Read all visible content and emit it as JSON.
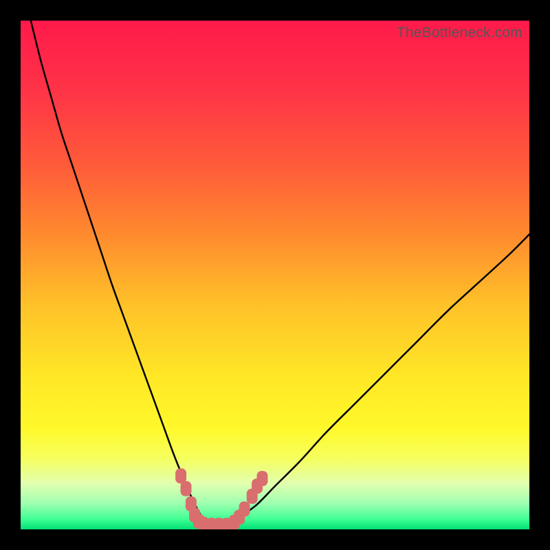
{
  "watermark": "TheBottleneck.com",
  "colors": {
    "frame": "#000000",
    "curve": "#000000",
    "marker": "#d96e6e",
    "gradient_stops": [
      {
        "offset": 0.0,
        "color": "#ff1a4b"
      },
      {
        "offset": 0.14,
        "color": "#ff3447"
      },
      {
        "offset": 0.28,
        "color": "#ff5a3a"
      },
      {
        "offset": 0.42,
        "color": "#ff8a2e"
      },
      {
        "offset": 0.56,
        "color": "#ffc229"
      },
      {
        "offset": 0.7,
        "color": "#ffe726"
      },
      {
        "offset": 0.8,
        "color": "#fff82a"
      },
      {
        "offset": 0.86,
        "color": "#f6ff5d"
      },
      {
        "offset": 0.91,
        "color": "#e2ffb0"
      },
      {
        "offset": 0.95,
        "color": "#9cffb0"
      },
      {
        "offset": 0.98,
        "color": "#3fff93"
      },
      {
        "offset": 1.0,
        "color": "#00e176"
      }
    ]
  },
  "chart_data": {
    "type": "line",
    "title": "",
    "xlabel": "",
    "ylabel": "",
    "xlim": [
      0,
      100
    ],
    "ylim": [
      0,
      100
    ],
    "grid": false,
    "legend": false,
    "series": [
      {
        "name": "bottleneck-curve",
        "x": [
          0,
          2,
          4,
          6,
          8,
          10,
          12,
          14,
          16,
          18,
          20,
          22,
          24,
          26,
          28,
          30,
          32,
          33.5,
          35,
          36,
          37.5,
          39,
          42,
          46,
          50,
          55,
          60,
          66,
          72,
          78,
          84,
          90,
          96,
          100
        ],
        "y": [
          108,
          100,
          92,
          85,
          78,
          72,
          66,
          60,
          54,
          48,
          42.5,
          37,
          31.5,
          26,
          20.5,
          15,
          10,
          6.5,
          3.5,
          2,
          1,
          1,
          2,
          4.5,
          8.5,
          13.5,
          19,
          25,
          31,
          37,
          43,
          48.5,
          54,
          58
        ]
      }
    ],
    "markers": {
      "name": "highlight-dots",
      "points": [
        {
          "x": 31.5,
          "y": 10.5
        },
        {
          "x": 32.5,
          "y": 8.0
        },
        {
          "x": 33.5,
          "y": 5.0
        },
        {
          "x": 34.2,
          "y": 2.8
        },
        {
          "x": 35.0,
          "y": 1.6
        },
        {
          "x": 36.0,
          "y": 1.0
        },
        {
          "x": 37.5,
          "y": 0.8
        },
        {
          "x": 39.0,
          "y": 0.8
        },
        {
          "x": 40.5,
          "y": 0.8
        },
        {
          "x": 42.0,
          "y": 1.4
        },
        {
          "x": 43.0,
          "y": 2.4
        },
        {
          "x": 44.0,
          "y": 4.0
        },
        {
          "x": 45.5,
          "y": 6.5
        },
        {
          "x": 46.5,
          "y": 8.5
        },
        {
          "x": 47.5,
          "y": 10.0
        }
      ]
    }
  }
}
